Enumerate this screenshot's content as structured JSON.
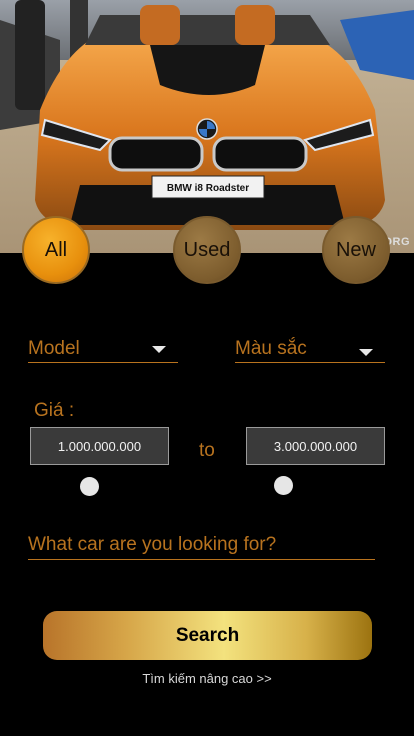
{
  "hero": {
    "image_alt": "Orange BMW i8 Roadster at a car show",
    "plate_text": "BMW i8 Roadster",
    "watermark": "ORG"
  },
  "filters": {
    "all": "All",
    "used": "Used",
    "new": "New",
    "selected": "All"
  },
  "model_dropdown": {
    "label": "Model"
  },
  "color_dropdown": {
    "label": "Màu sắc"
  },
  "price": {
    "label": "Giá :",
    "min": "1.000.000.000",
    "to_label": "to",
    "max": "3.000.000.000"
  },
  "search": {
    "placeholder": "What car are you looking for?",
    "button_label": "Search"
  },
  "advanced_link": "Tìm kiếm nâng cao  >>",
  "colors": {
    "accent": "#b8731f",
    "background": "#000000"
  }
}
